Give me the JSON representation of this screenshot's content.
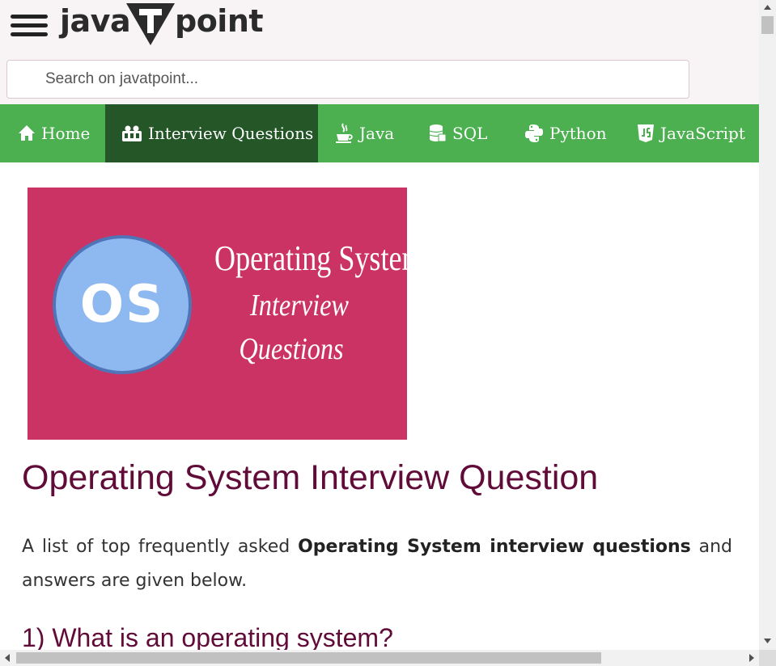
{
  "header": {
    "logo_left": "java",
    "logo_right": "point",
    "logo_t": "T",
    "search": {
      "placeholder": "Search on javatpoint...",
      "value": ""
    }
  },
  "nav": {
    "items": [
      {
        "label": "Home",
        "icon": "home-icon",
        "active": false
      },
      {
        "label": "Interview Questions",
        "icon": "interview-icon",
        "active": true
      },
      {
        "label": "Java",
        "icon": "java-cup-icon",
        "active": false
      },
      {
        "label": "SQL",
        "icon": "database-icon",
        "active": false
      },
      {
        "label": "Python",
        "icon": "python-icon",
        "active": false
      },
      {
        "label": "JavaScript",
        "icon": "js-icon",
        "active": false
      }
    ]
  },
  "banner": {
    "badge": "OS",
    "line1": "Operating System",
    "line2": "Interview",
    "line3": "Questions"
  },
  "article": {
    "title": "Operating System Interview Question",
    "intro_before": "A list of top frequently asked ",
    "intro_bold": "Operating System interview questions",
    "intro_after": " and answers are given below.",
    "first_question": "1) What is an operating system?"
  },
  "colors": {
    "nav_bg": "#4caf50",
    "nav_active": "#245628",
    "title": "#610b38",
    "banner_bg": "#cb3364",
    "header_bg": "#f8f3f5"
  }
}
